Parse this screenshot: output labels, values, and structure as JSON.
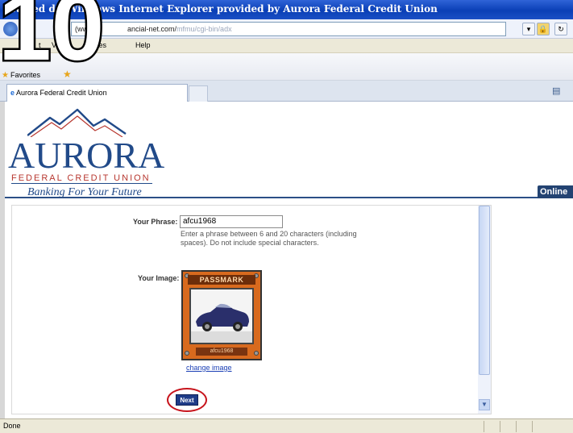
{
  "window": {
    "title": "ra Fed       dit         Windows Internet Explorer provided by Aurora Federal Credit Union"
  },
  "address_bar": {
    "url_prefix": "(www",
    "url_main": "ancial-net.com/",
    "url_rest": "mfmu/cgi-bin/adx"
  },
  "menu": {
    "items": [
      "t",
      "Vi",
      "ites",
      "Help"
    ]
  },
  "favorites": {
    "label": "Favorites"
  },
  "tab": {
    "label": "Aurora Federal Credit Union"
  },
  "brand": {
    "name": "AURORA",
    "subtitle": "FEDERAL CREDIT UNION",
    "tagline": "Banking For Your Future",
    "online_label": "Online"
  },
  "form": {
    "phrase_label": "Your Phrase:",
    "phrase_value": "afcu1968",
    "phrase_hint": "Enter a phrase between 6 and 20 characters (including spaces). Do not include special characters.",
    "image_label": "Your Image:",
    "passmark_title": "PASSMARK",
    "passmark_caption": "afcu1968",
    "change_image_link": "change image",
    "next_button": "Next"
  },
  "status": {
    "text": "Done"
  },
  "overlay": {
    "step": "10"
  },
  "colors": {
    "brand_blue": "#214a89",
    "brand_red": "#b7372f",
    "next_ring": "#c7141c",
    "passmark_orange": "#d86a1e"
  }
}
